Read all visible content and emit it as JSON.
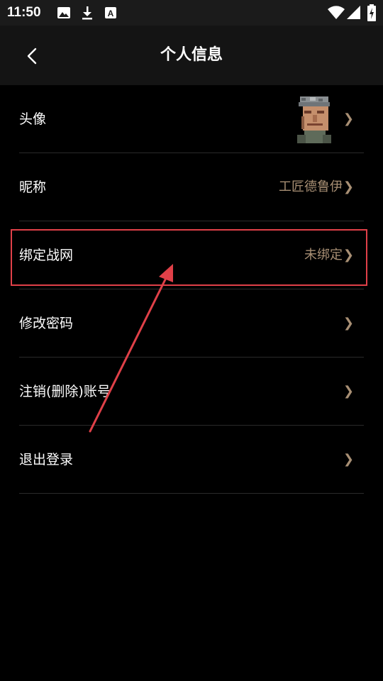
{
  "status_bar": {
    "time": "11:50",
    "icons": [
      "image-icon",
      "download-icon",
      "a-badge-icon",
      "wifi-icon",
      "signal-icon",
      "battery-charging-icon"
    ]
  },
  "header": {
    "title": "个人信息",
    "back_icon": "back-arrow-icon"
  },
  "rows": [
    {
      "label": "头像",
      "value": "",
      "chevron": "❯"
    },
    {
      "label": "昵称",
      "value": "工匠德鲁伊",
      "chevron": "❯"
    },
    {
      "label": "绑定战网",
      "value": "未绑定",
      "chevron": "❯"
    },
    {
      "label": "修改密码",
      "value": "",
      "chevron": "❯"
    },
    {
      "label": "注销(删除)账号",
      "value": "",
      "chevron": "❯"
    },
    {
      "label": "退出登录",
      "value": "",
      "chevron": "❯"
    }
  ],
  "annotation": {
    "highlight_color": "#e04048",
    "target_row": "绑定战网"
  },
  "colors": {
    "background": "#000000",
    "header": "#141414",
    "accent_value": "#a88f74"
  }
}
